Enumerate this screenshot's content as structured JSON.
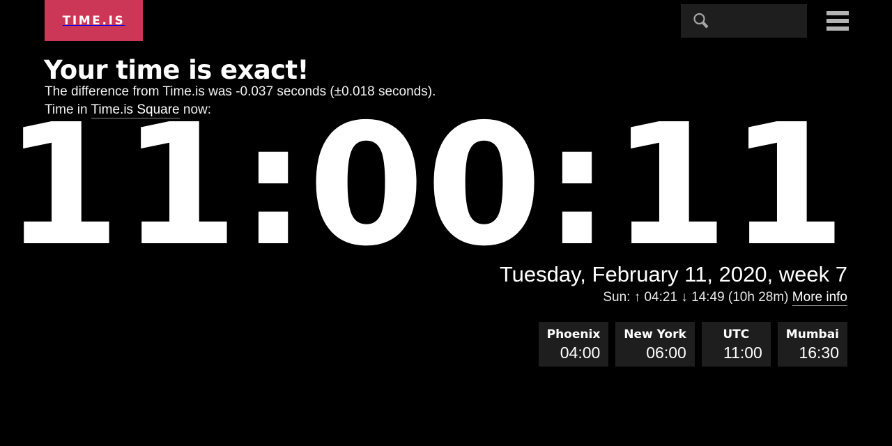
{
  "site": {
    "logo_text": "TIME.IS",
    "logo_color": "#cd3757",
    "background_color": "#000000"
  },
  "header": {
    "search": {
      "icon": "search-icon",
      "value": "",
      "placeholder": ""
    },
    "menu": {
      "icon": "hamburger-menu-icon"
    }
  },
  "main": {
    "headline": "Your time is exact!",
    "difference_text": "The difference from Time.is was -0.037 seconds (±0.018 seconds).",
    "location_prefix": "Time in ",
    "location_link": "Time.is Square",
    "location_suffix": " now:",
    "clock": "11:00:11",
    "date": "Tuesday, February 11, 2020, week 7",
    "sun": {
      "label": "Sun: ",
      "sunrise_arrow": "↑",
      "sunrise": "04:21",
      "sunset_arrow": "↓",
      "sunset": "14:49",
      "daylength": "(10h 28m)",
      "more_info": "More info",
      "full_text": "Sun: ↑ 04:21 ↓ 14:49 (10h 28m)"
    }
  },
  "cities": [
    {
      "name": "Phoenix",
      "time": "04:00"
    },
    {
      "name": "New York",
      "time": "06:00"
    },
    {
      "name": "UTC",
      "time": "11:00"
    },
    {
      "name": "Mumbai",
      "time": "16:30"
    }
  ]
}
